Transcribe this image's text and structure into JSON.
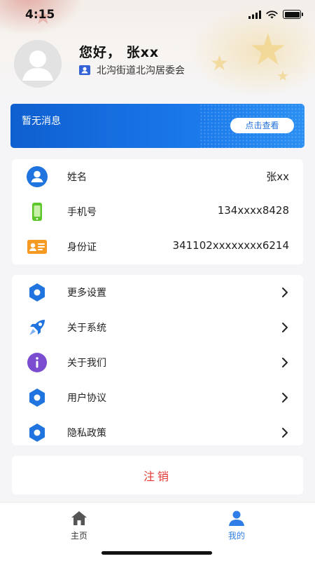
{
  "status_bar": {
    "time": "4:15"
  },
  "profile": {
    "greeting": "您好， 张xx",
    "community": "北沟街道北沟居委会"
  },
  "banner": {
    "message": "暂无消息",
    "button_label": "点击查看"
  },
  "info": [
    {
      "label": "姓名",
      "value": "张xx",
      "icon": "user-icon",
      "color": "#1f74e0"
    },
    {
      "label": "手机号",
      "value": "134xxxx8428",
      "icon": "phone-icon",
      "color": "#5cc62a"
    },
    {
      "label": "身份证",
      "value": "341102xxxxxxxx6214",
      "icon": "id-card-icon",
      "color": "#f59a23"
    }
  ],
  "menu": [
    {
      "label": "更多设置",
      "icon": "settings-hexagon-icon"
    },
    {
      "label": "关于系统",
      "icon": "rocket-icon"
    },
    {
      "label": "关于我们",
      "icon": "info-icon"
    },
    {
      "label": "用户协议",
      "icon": "agreement-hexagon-icon"
    },
    {
      "label": "隐私政策",
      "icon": "privacy-hexagon-icon"
    }
  ],
  "logout": {
    "label": "注销",
    "color": "#e53935"
  },
  "tabs": [
    {
      "label": "主页",
      "icon": "home-icon",
      "active": false
    },
    {
      "label": "我的",
      "icon": "profile-icon",
      "active": true
    }
  ],
  "colors": {
    "accent": "#2f7de6",
    "banner": "#1a78ea",
    "danger": "#e53935"
  }
}
